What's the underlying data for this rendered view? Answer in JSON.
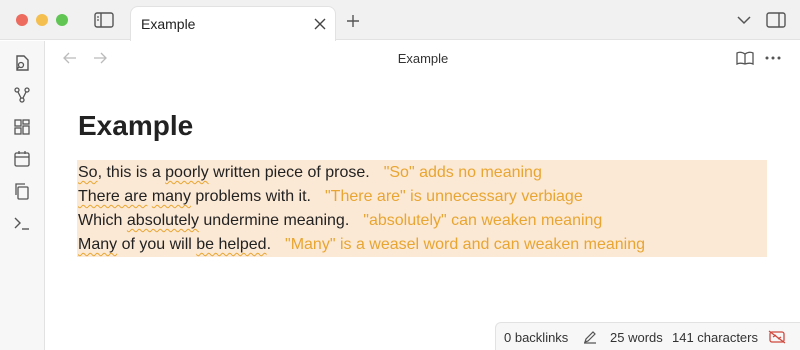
{
  "tab": {
    "title": "Example"
  },
  "view": {
    "title": "Example"
  },
  "document": {
    "title": "Example",
    "lines": [
      {
        "pre": "",
        "flag": "So",
        "post": ", this is a ",
        "flag2": "poorly",
        "post2": " written piece of prose.",
        "note": "\"So\" adds no meaning"
      },
      {
        "pre": "",
        "flag": "There are",
        "post": " ",
        "flag2": "many",
        "post2": " problems with it.",
        "note": "\"There are\" is unnecessary verbiage"
      },
      {
        "pre": "Which ",
        "flag": "absolutely",
        "post": " undermine meaning.",
        "flag2": "",
        "post2": "",
        "note": "\"absolutely\" can weaken meaning"
      },
      {
        "pre": "",
        "flag": "Many",
        "post": " of you will ",
        "flag2": "be helped",
        "post2": ".",
        "note": "\"Many\" is a weasel word and can weaken meaning"
      }
    ]
  },
  "statusbar": {
    "backlinks": "0 backlinks",
    "words": "25 words",
    "characters": "141 characters"
  },
  "colors": {
    "highlight": "#fce9d5",
    "suggestion": "#e8a531"
  }
}
